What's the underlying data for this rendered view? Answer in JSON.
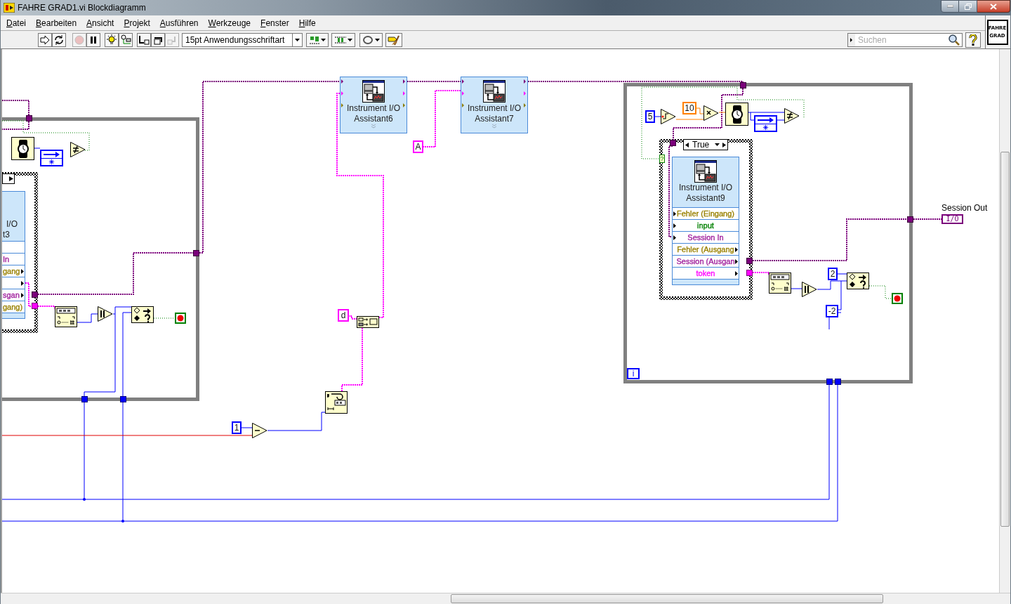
{
  "window": {
    "title": "FAHRE GRAD1.vi Blockdiagramm"
  },
  "menu": [
    "Datei",
    "Bearbeiten",
    "Ansicht",
    "Projekt",
    "Ausführen",
    "Werkzeuge",
    "Fenster",
    "Hilfe"
  ],
  "toolbar": {
    "buttons": [
      {
        "kind": "run",
        "disabled": false
      },
      {
        "kind": "run-continuous",
        "disabled": false
      },
      {
        "kind": "abort",
        "disabled": true
      },
      {
        "kind": "pause",
        "disabled": false
      },
      {
        "kind": "highlight",
        "disabled": false
      },
      {
        "kind": "retain",
        "disabled": false
      },
      {
        "kind": "step-into",
        "disabled": false
      },
      {
        "kind": "step-over",
        "disabled": false
      },
      {
        "kind": "step-out",
        "disabled": true
      }
    ],
    "font_select": "15pt Anwendungsschriftart",
    "search": {
      "placeholder": "Suchen"
    }
  },
  "vi_icon": {
    "lines": [
      "FAHRE",
      "GRAD"
    ]
  },
  "diagram": {
    "express_vis": [
      {
        "label": "Instrument I/O Assistant6"
      },
      {
        "label": "Instrument I/O Assistant7"
      }
    ],
    "left_node": {
      "label_lines": [
        "I/O",
        "t3"
      ],
      "terminals": [
        {
          "kind": "input"
        },
        {
          "kind": "input",
          "text": "In",
          "color": "#a0209d"
        },
        {
          "kind": "output",
          "text": "gang",
          "color": "#998000"
        },
        {
          "kind": "output"
        },
        {
          "kind": "output",
          "text": "sgan",
          "color": "#a0209d"
        },
        {
          "kind": "input",
          "text": "gang)",
          "color": "#998000"
        }
      ]
    },
    "case_node": {
      "label": "Instrument I/O Assistant9",
      "terminals": [
        {
          "kind": "input",
          "text": "Fehler (Eingang)",
          "color": "#998000"
        },
        {
          "kind": "input",
          "text": "input",
          "color": "#008000"
        },
        {
          "kind": "input",
          "text": "Session In",
          "color": "#a0209d"
        },
        {
          "kind": "output",
          "text": "Fehler (Ausgang",
          "color": "#998000"
        },
        {
          "kind": "output",
          "text": "Session (Ausgan",
          "color": "#a0209d"
        },
        {
          "kind": "output",
          "text": "token",
          "color": "#ff00ff"
        }
      ]
    },
    "case_selector": "True",
    "constants": [
      {
        "text": "5",
        "color": "#0000ff"
      },
      {
        "text": "10",
        "color": "#ff8000"
      },
      {
        "text": "2",
        "color": "#0000ff"
      },
      {
        "text": "-2",
        "color": "#0000ff"
      },
      {
        "text": "1",
        "color": "#0000ff"
      },
      {
        "text": "A",
        "color": "#ff00ff"
      },
      {
        "text": "d",
        "color": "#ff00ff"
      }
    ],
    "iteration": "i",
    "conditional": "?",
    "indicator": {
      "label": "Session Out",
      "value": "I/O"
    }
  }
}
